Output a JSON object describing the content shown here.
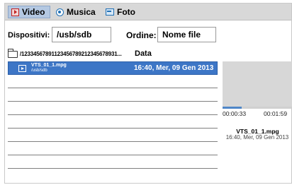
{
  "tabs": [
    {
      "label": "Video",
      "icon": "video-icon",
      "active": true
    },
    {
      "label": "Musica",
      "icon": "music-icon",
      "active": false
    },
    {
      "label": "Foto",
      "icon": "photo-icon",
      "active": false
    }
  ],
  "device": {
    "label": "Dispositivi:",
    "value": "/usb/sdb"
  },
  "order": {
    "label": "Ordine:",
    "value": "Nome file"
  },
  "path": {
    "text": "/12334567891123456789212345678931...",
    "icon": "folder-icon"
  },
  "list": {
    "date_header": "Data",
    "selected": {
      "name": "VTS_01_1.mpg",
      "location": "/usb/sdb",
      "date": "16:40, Mer, 09 Gen 2013"
    }
  },
  "preview": {
    "current_time": "00:00:33",
    "total_time": "00:01:59",
    "progress": 0.277,
    "file_name": "VTS_01_1.mpg",
    "file_date": "16:40, Mer, 09 Gen 2013"
  },
  "colors": {
    "accent": "#3d76c6",
    "tab_active": "#b4c8e2",
    "tabbar": "#d8d8d8"
  }
}
